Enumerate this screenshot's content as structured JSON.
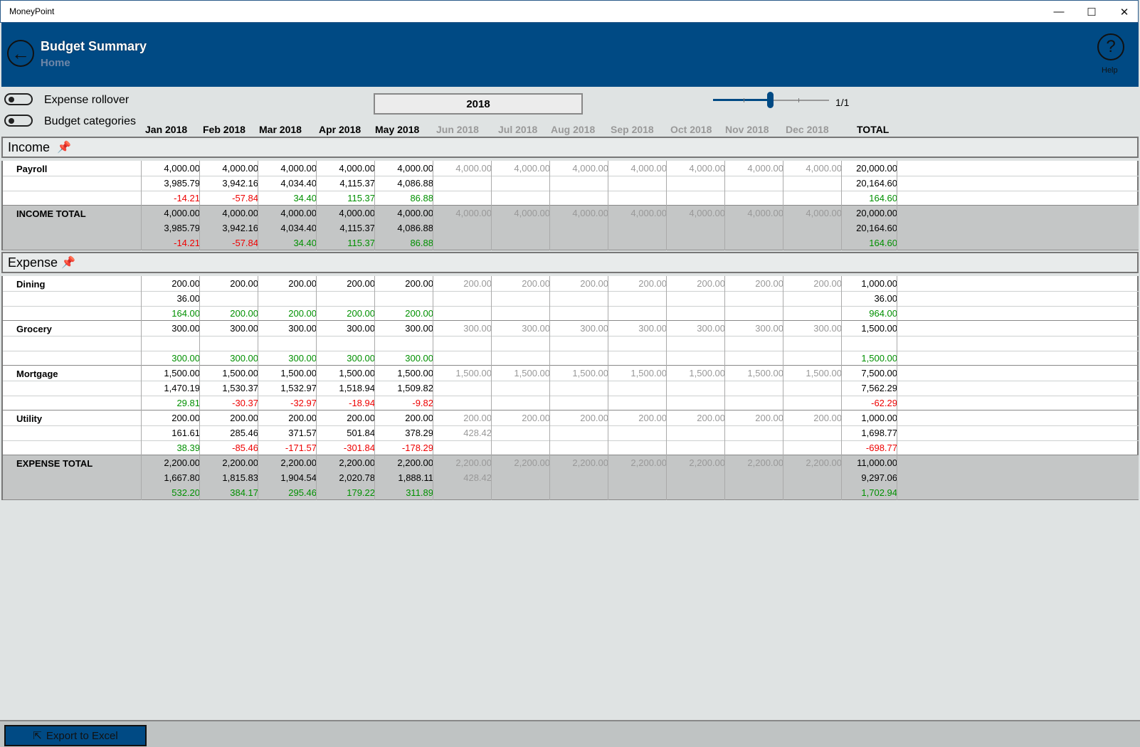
{
  "window": {
    "title": "MoneyPoint",
    "minimize": "—",
    "maximize": "☐",
    "close": "✕"
  },
  "header": {
    "title": "Budget Summary",
    "subtitle": "Home",
    "help_label": "Help",
    "back_glyph": "←",
    "help_glyph": "?"
  },
  "controls": {
    "expense_rollover_label": "Expense rollover",
    "budget_categories_label": "Budget categories",
    "year": "2018",
    "page_indicator": "1/1",
    "slider_level_fraction": 0.5
  },
  "columns": [
    {
      "label": "Jan 2018",
      "dim": false
    },
    {
      "label": "Feb 2018",
      "dim": false
    },
    {
      "label": "Mar 2018",
      "dim": false
    },
    {
      "label": "Apr 2018",
      "dim": false
    },
    {
      "label": "May 2018",
      "dim": false
    },
    {
      "label": "Jun 2018",
      "dim": true
    },
    {
      "label": "Jul 2018",
      "dim": true
    },
    {
      "label": "Aug 2018",
      "dim": true
    },
    {
      "label": "Sep 2018",
      "dim": true
    },
    {
      "label": "Oct 2018",
      "dim": true
    },
    {
      "label": "Nov 2018",
      "dim": true
    },
    {
      "label": "Dec 2018",
      "dim": true
    },
    {
      "label": "TOTAL",
      "dim": false
    }
  ],
  "sections": [
    {
      "title": "Income",
      "pin_icon": "📌",
      "rows": [
        {
          "label": "Payroll",
          "total": false,
          "budget": [
            "4,000.00",
            "4,000.00",
            "4,000.00",
            "4,000.00",
            "4,000.00",
            "4,000.00",
            "4,000.00",
            "4,000.00",
            "4,000.00",
            "4,000.00",
            "4,000.00",
            "4,000.00",
            "20,000.00"
          ],
          "actual": [
            "3,985.79",
            "3,942.16",
            "4,034.40",
            "4,115.37",
            "4,086.88",
            "",
            "",
            "",
            "",
            "",
            "",
            "",
            "20,164.60"
          ],
          "diff": [
            "-14.21",
            "-57.84",
            "34.40",
            "115.37",
            "86.88",
            "",
            "",
            "",
            "",
            "",
            "",
            "",
            "164.60"
          ]
        },
        {
          "label": "INCOME TOTAL",
          "total": true,
          "budget": [
            "4,000.00",
            "4,000.00",
            "4,000.00",
            "4,000.00",
            "4,000.00",
            "4,000.00",
            "4,000.00",
            "4,000.00",
            "4,000.00",
            "4,000.00",
            "4,000.00",
            "4,000.00",
            "20,000.00"
          ],
          "actual": [
            "3,985.79",
            "3,942.16",
            "4,034.40",
            "4,115.37",
            "4,086.88",
            "",
            "",
            "",
            "",
            "",
            "",
            "",
            "20,164.60"
          ],
          "diff": [
            "-14.21",
            "-57.84",
            "34.40",
            "115.37",
            "86.88",
            "",
            "",
            "",
            "",
            "",
            "",
            "",
            "164.60"
          ]
        }
      ]
    },
    {
      "title": "Expense",
      "pin_icon": "📌",
      "rows": [
        {
          "label": "Dining",
          "total": false,
          "budget": [
            "200.00",
            "200.00",
            "200.00",
            "200.00",
            "200.00",
            "200.00",
            "200.00",
            "200.00",
            "200.00",
            "200.00",
            "200.00",
            "200.00",
            "1,000.00"
          ],
          "actual": [
            "36.00",
            "",
            "",
            "",
            "",
            "",
            "",
            "",
            "",
            "",
            "",
            "",
            "36.00"
          ],
          "diff": [
            "164.00",
            "200.00",
            "200.00",
            "200.00",
            "200.00",
            "",
            "",
            "",
            "",
            "",
            "",
            "",
            "964.00"
          ]
        },
        {
          "label": "Grocery",
          "total": false,
          "budget": [
            "300.00",
            "300.00",
            "300.00",
            "300.00",
            "300.00",
            "300.00",
            "300.00",
            "300.00",
            "300.00",
            "300.00",
            "300.00",
            "300.00",
            "1,500.00"
          ],
          "actual": [
            "",
            "",
            "",
            "",
            "",
            "",
            "",
            "",
            "",
            "",
            "",
            "",
            ""
          ],
          "diff": [
            "300.00",
            "300.00",
            "300.00",
            "300.00",
            "300.00",
            "",
            "",
            "",
            "",
            "",
            "",
            "",
            "1,500.00"
          ]
        },
        {
          "label": "Mortgage",
          "total": false,
          "budget": [
            "1,500.00",
            "1,500.00",
            "1,500.00",
            "1,500.00",
            "1,500.00",
            "1,500.00",
            "1,500.00",
            "1,500.00",
            "1,500.00",
            "1,500.00",
            "1,500.00",
            "1,500.00",
            "7,500.00"
          ],
          "actual": [
            "1,470.19",
            "1,530.37",
            "1,532.97",
            "1,518.94",
            "1,509.82",
            "",
            "",
            "",
            "",
            "",
            "",
            "",
            "7,562.29"
          ],
          "diff": [
            "29.81",
            "-30.37",
            "-32.97",
            "-18.94",
            "-9.82",
            "",
            "",
            "",
            "",
            "",
            "",
            "",
            "-62.29"
          ]
        },
        {
          "label": "Utility",
          "total": false,
          "budget": [
            "200.00",
            "200.00",
            "200.00",
            "200.00",
            "200.00",
            "200.00",
            "200.00",
            "200.00",
            "200.00",
            "200.00",
            "200.00",
            "200.00",
            "1,000.00"
          ],
          "actual": [
            "161.61",
            "285.46",
            "371.57",
            "501.84",
            "378.29",
            "428.42",
            "",
            "",
            "",
            "",
            "",
            "",
            "1,698.77"
          ],
          "diff": [
            "38.39",
            "-85.46",
            "-171.57",
            "-301.84",
            "-178.29",
            "",
            "",
            "",
            "",
            "",
            "",
            "",
            "-698.77"
          ]
        },
        {
          "label": "EXPENSE TOTAL",
          "total": true,
          "budget": [
            "2,200.00",
            "2,200.00",
            "2,200.00",
            "2,200.00",
            "2,200.00",
            "2,200.00",
            "2,200.00",
            "2,200.00",
            "2,200.00",
            "2,200.00",
            "2,200.00",
            "2,200.00",
            "11,000.00"
          ],
          "actual": [
            "1,667.80",
            "1,815.83",
            "1,904.54",
            "2,020.78",
            "1,888.11",
            "428.42",
            "",
            "",
            "",
            "",
            "",
            "",
            "9,297.06"
          ],
          "diff": [
            "532.20",
            "384.17",
            "295.46",
            "179.22",
            "311.89",
            "",
            "",
            "",
            "",
            "",
            "",
            "",
            "1,702.94"
          ]
        }
      ]
    }
  ],
  "footer": {
    "export_label": "Export to Excel",
    "export_icon": "⇱"
  },
  "colors": {
    "accent": "#004a84",
    "negative": "#e00000",
    "positive": "#009000",
    "dim": "#999999",
    "total_row": "#c4c6c6"
  }
}
